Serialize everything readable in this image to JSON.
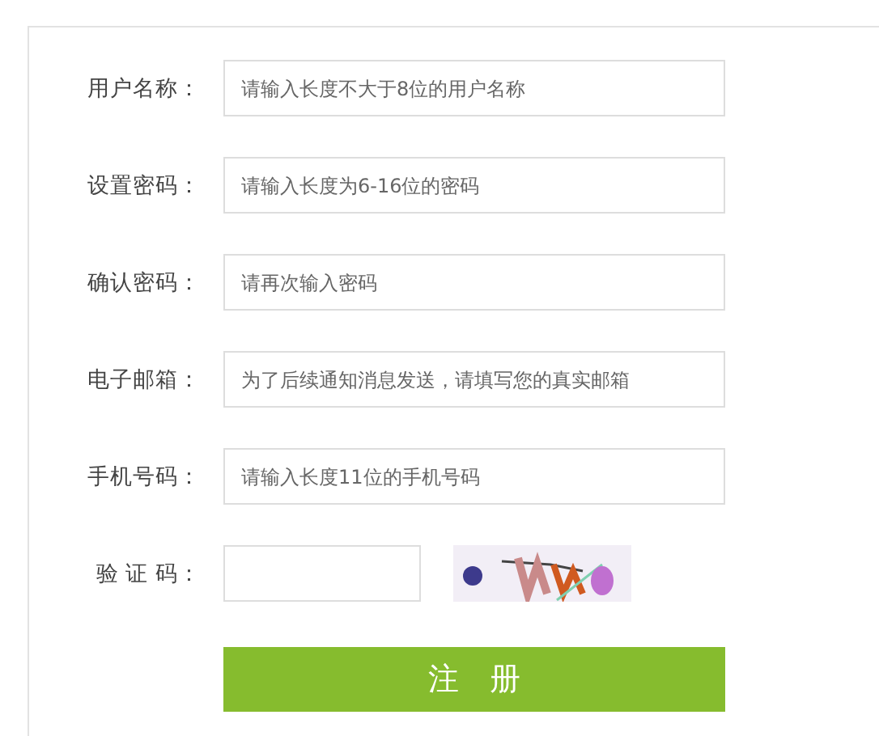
{
  "fields": [
    {
      "label": "用户名称：",
      "placeholder": "请输入长度不大于8位的用户名称"
    },
    {
      "label": "设置密码：",
      "placeholder": "请输入长度为6-16位的密码"
    },
    {
      "label": "确认密码：",
      "placeholder": "请再次输入密码"
    },
    {
      "label": "电子邮箱：",
      "placeholder": "为了后续通知消息发送，请填写您的真实邮箱"
    },
    {
      "label": "手机号码：",
      "placeholder": "请输入长度11位的手机号码"
    }
  ],
  "captcha": {
    "label": "验 证 码："
  },
  "submit": "注　册"
}
